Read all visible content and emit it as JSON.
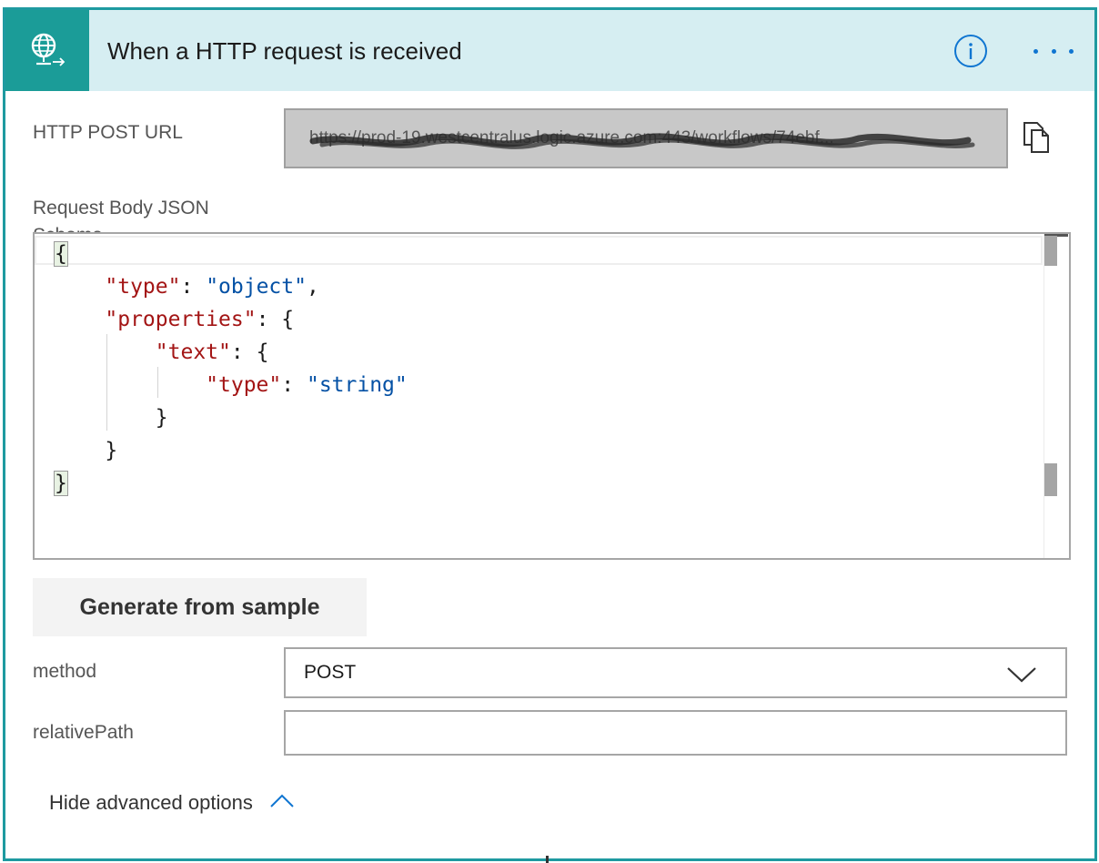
{
  "header": {
    "title": "When a HTTP request is received",
    "icon": "globe-request-icon",
    "accent_color": "#1b9c98",
    "background_color": "#d6eef2"
  },
  "http_post_url": {
    "label": "HTTP POST URL",
    "value": "https://prod-19.westcentralus.logic.azure.com:443/workflows/74ebf..."
  },
  "request_body_schema": {
    "label": "Request Body JSON Schema",
    "code_lines": [
      "{",
      "    \"type\": \"object\",",
      "    \"properties\": {",
      "        \"text\": {",
      "            \"type\": \"string\"",
      "        }",
      "    }",
      "}"
    ],
    "tokens": {
      "type_key": "\"type\"",
      "object_val": "\"object\"",
      "properties_key": "\"properties\"",
      "text_key": "\"text\"",
      "string_val": "\"string\""
    }
  },
  "generate_button": {
    "label": "Generate from sample"
  },
  "method": {
    "label": "method",
    "selected": "POST"
  },
  "relative_path": {
    "label": "relativePath",
    "value": ""
  },
  "advanced_toggle": {
    "label": "Hide advanced options"
  }
}
